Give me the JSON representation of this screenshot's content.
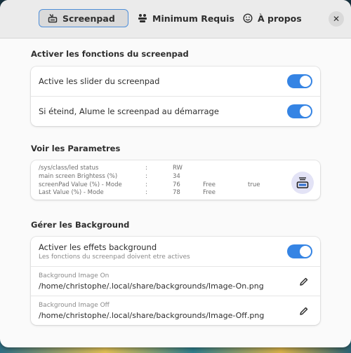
{
  "tabs": [
    {
      "label": "Screenpad",
      "icon": "screenpad-icon",
      "active": true
    },
    {
      "label": "Minimum Requis",
      "icon": "requirements-icon",
      "active": false
    },
    {
      "label": "À propos",
      "icon": "smiley-icon",
      "active": false
    }
  ],
  "close_label": "✕",
  "sections": {
    "functions": {
      "title": "Activer les fonctions du screenpad",
      "rows": [
        {
          "label": "Active les slider du screenpad",
          "enabled": true
        },
        {
          "label": "Si éteind, Alume le screenpad au démarrage",
          "enabled": true
        }
      ]
    },
    "params": {
      "title": "Voir les Parametres",
      "lines": [
        {
          "name": "/sys/class/led status",
          "sep": ":",
          "value": "RW",
          "extra1": "",
          "extra2": ""
        },
        {
          "name": "main screen Brightess (%)",
          "sep": ":",
          "value": "34",
          "extra1": "",
          "extra2": ""
        },
        {
          "name": "screenPad Value (%) - Mode",
          "sep": ":",
          "value": "76",
          "extra1": "Free",
          "extra2": "true"
        },
        {
          "name": "Last Value (%) - Mode",
          "sep": ":",
          "value": "78",
          "extra1": "Free",
          "extra2": ""
        }
      ]
    },
    "background": {
      "title": "Gérer les Background",
      "effects_label": "Activer les effets background",
      "effects_sublabel": "Les fonctions du screenpad doivent etre actives",
      "effects_enabled": true,
      "image_on_label": "Background Image On",
      "image_on_path": "/home/christophe/.local/share/backgrounds/Image-On.png",
      "image_off_label": "Background Image Off",
      "image_off_path": "/home/christophe/.local/share/backgrounds/Image-Off.png"
    }
  },
  "colors": {
    "accent": "#3584e4",
    "window_bg": "#fafafa",
    "header_bg": "#ebebeb"
  }
}
